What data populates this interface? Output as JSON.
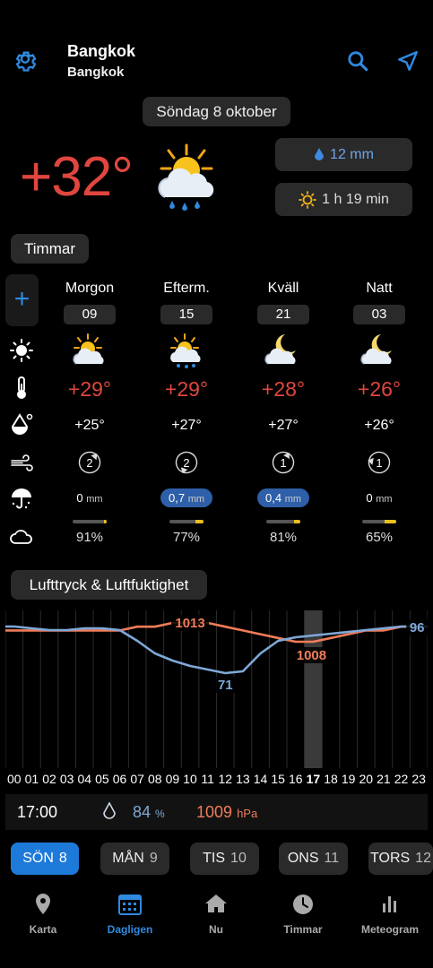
{
  "header": {
    "city": "Bangkok",
    "region": "Bangkok",
    "settings_icon": "gear-icon",
    "search_icon": "search-icon",
    "location_icon": "location-arrow-icon"
  },
  "date": "Söndag 8 oktober",
  "current": {
    "temperature": "+32°",
    "condition_icon": "partly-cloudy-rain-icon",
    "precipitation": "12 mm",
    "sunshine": "1 h 19 min"
  },
  "section_hours_label": "Timmar",
  "add_label": "+",
  "periods": [
    {
      "name": "Morgon",
      "hour": "09",
      "temp": "+29°",
      "feels": "+25°",
      "wind": "2",
      "precip_value": "0",
      "precip_unit": "mm",
      "precip_highlight": false,
      "cloud_pct": "91%",
      "cloud_fraction": 0.09
    },
    {
      "name": "Efterm.",
      "hour": "15",
      "temp": "+29°",
      "feels": "+27°",
      "wind": "2",
      "precip_value": "0,7",
      "precip_unit": "mm",
      "precip_highlight": true,
      "cloud_pct": "77%",
      "cloud_fraction": 0.23
    },
    {
      "name": "Kväll",
      "hour": "21",
      "temp": "+28°",
      "feels": "+27°",
      "wind": "1",
      "precip_value": "0,4",
      "precip_unit": "mm",
      "precip_highlight": true,
      "cloud_pct": "81%",
      "cloud_fraction": 0.19
    },
    {
      "name": "Natt",
      "hour": "03",
      "temp": "+26°",
      "feels": "+26°",
      "wind": "1",
      "precip_value": "0",
      "precip_unit": "mm",
      "precip_highlight": false,
      "cloud_pct": "65%",
      "cloud_fraction": 0.35
    }
  ],
  "section_pressure_label": "Lufttryck & Luftfuktighet",
  "chart_data": {
    "type": "line",
    "x": [
      "00",
      "01",
      "02",
      "03",
      "04",
      "05",
      "06",
      "07",
      "08",
      "09",
      "10",
      "11",
      "12",
      "13",
      "14",
      "15",
      "16",
      "17",
      "18",
      "19",
      "20",
      "21",
      "22",
      "23"
    ],
    "series": [
      {
        "name": "humidity",
        "unit": "%",
        "values": [
          97,
          96,
          95,
          95,
          96,
          96,
          95,
          89,
          82,
          78,
          75,
          73,
          71,
          72,
          82,
          89,
          91,
          92,
          93,
          94,
          95,
          96,
          97,
          97
        ]
      },
      {
        "name": "pressure",
        "unit": "hPa",
        "values": [
          1011,
          1011,
          1011,
          1011,
          1011,
          1011,
          1011,
          1012,
          1012,
          1013,
          1013,
          1013,
          1012,
          1011,
          1010,
          1009,
          1008,
          1008,
          1009,
          1010,
          1011,
          1011,
          1012,
          1012
        ]
      }
    ],
    "labels": {
      "pressure_max": "1013",
      "pressure_min": "1008",
      "humidity_min": "71",
      "humidity_max": "96"
    },
    "highlight_hour": "17"
  },
  "readout": {
    "time": "17:00",
    "humidity": "84",
    "humidity_unit": "%",
    "pressure": "1009",
    "pressure_unit": "hPa"
  },
  "days": [
    {
      "name": "SÖN",
      "num": "8",
      "active": true
    },
    {
      "name": "MÅN",
      "num": "9",
      "active": false
    },
    {
      "name": "TIS",
      "num": "10",
      "active": false
    },
    {
      "name": "ONS",
      "num": "11",
      "active": false
    },
    {
      "name": "TORS",
      "num": "12",
      "active": false
    }
  ],
  "nav": [
    {
      "label": "Karta",
      "icon": "map-pin-icon",
      "active": false
    },
    {
      "label": "Dagligen",
      "icon": "calendar-icon",
      "active": true
    },
    {
      "label": "Nu",
      "icon": "home-icon",
      "active": false
    },
    {
      "label": "Timmar",
      "icon": "clock-icon",
      "active": false
    },
    {
      "label": "Meteogram",
      "icon": "bar-chart-icon",
      "active": false
    }
  ],
  "colors": {
    "accent": "#2f8ae0",
    "temp_red": "#e0463f",
    "humidity_blue": "#7fa8d8",
    "pressure_orange": "#f07c5a"
  }
}
